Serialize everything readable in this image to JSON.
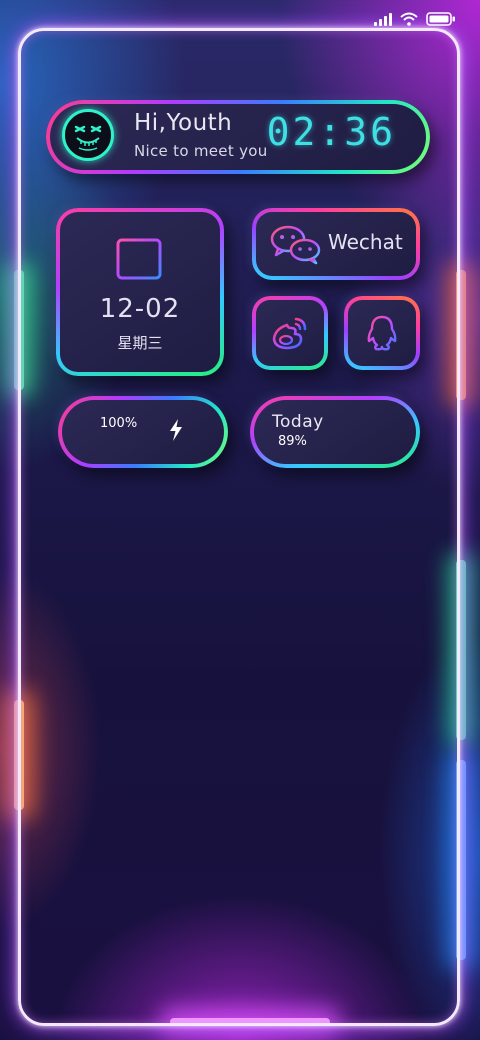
{
  "status_bar": {
    "signal_icon": "signal-icon",
    "wifi_icon": "wifi-icon",
    "battery_icon": "battery-icon"
  },
  "header": {
    "avatar_icon": "mask-face-icon",
    "greeting": "Hi,Youth",
    "subtitle": "Nice to meet you",
    "time": "02:36"
  },
  "calendar": {
    "icon": "calendar-icon",
    "date": "12-02",
    "weekday": "星期三"
  },
  "apps": {
    "wechat_label": "Wechat",
    "wechat_icon": "wechat-icon",
    "weibo_icon": "weibo-icon",
    "qq_icon": "qq-icon"
  },
  "battery": {
    "percent": "100%",
    "icon": "lightning-bolt-icon"
  },
  "today": {
    "label": "Today",
    "value": "89%"
  },
  "colors": {
    "accent_cyan": "#3fe0e4",
    "frame": "#f4e8ff",
    "background": "#1d1a4c"
  }
}
